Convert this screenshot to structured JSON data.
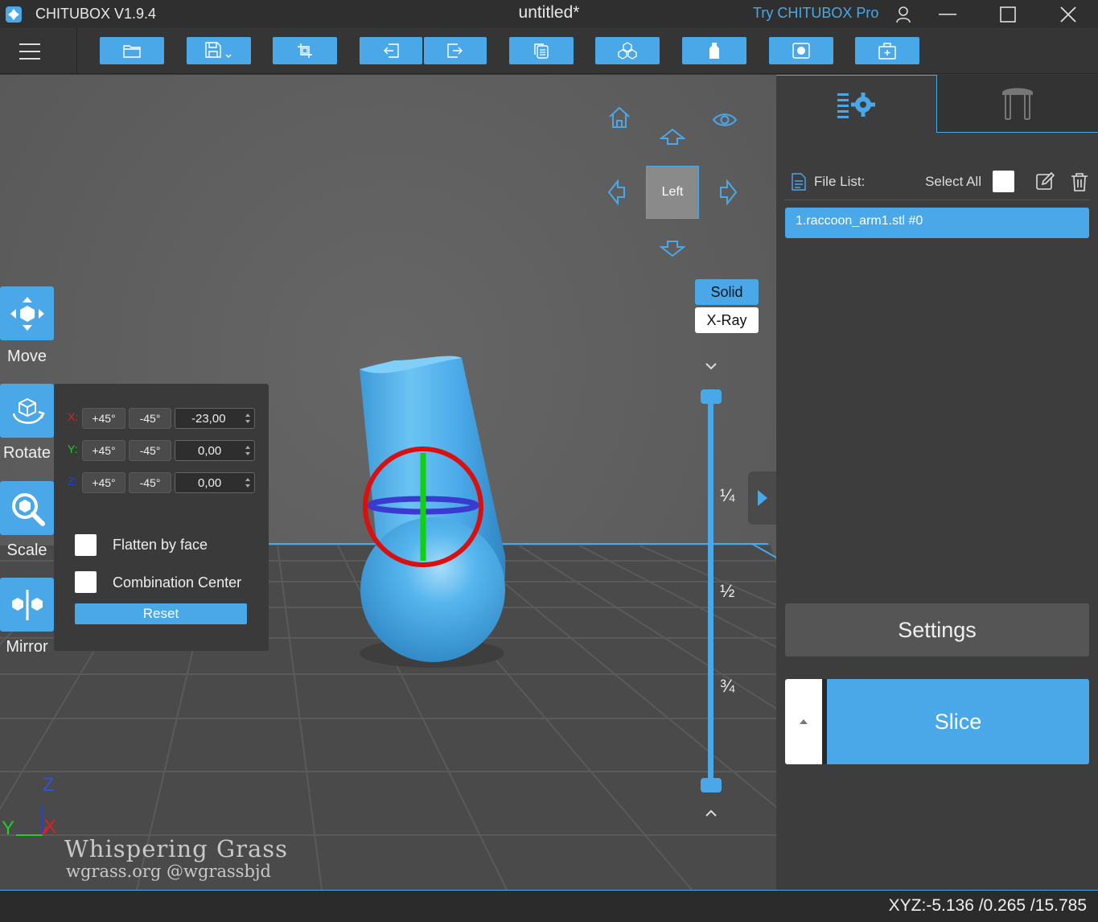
{
  "titlebar": {
    "app_name": "CHITUBOX V1.9.4",
    "document_title": "untitled*",
    "try_pro": "Try CHITUBOX Pro"
  },
  "toolbar": {
    "buttons": [
      "open-file-icon",
      "save-icon",
      "crop-icon",
      "undo-icon",
      "redo-icon",
      "copy-icon",
      "arrange-icon",
      "hollow-icon",
      "dig-hole-icon",
      "supports-icon"
    ]
  },
  "viewport": {
    "view_cube_label": "Left",
    "render_modes": {
      "solid": "Solid",
      "xray": "X-Ray"
    },
    "slider_marks": [
      "¼",
      "½",
      "¾"
    ],
    "axis": {
      "z": "Z",
      "y": "Y",
      "x": "X"
    },
    "watermark": {
      "line1": "Whispering Grass",
      "line2": "wgrass.org @wgrassbjd"
    }
  },
  "tools": {
    "move": "Move",
    "rotate": "Rotate",
    "scale": "Scale",
    "mirror": "Mirror"
  },
  "rotate_panel": {
    "rows": [
      {
        "axis": "X:",
        "plus": "+45°",
        "minus": "-45°",
        "value": "-23,00",
        "color": "#e02020"
      },
      {
        "axis": "Y:",
        "plus": "+45°",
        "minus": "-45°",
        "value": "0,00",
        "color": "#20d020"
      },
      {
        "axis": "Z:",
        "plus": "+45°",
        "minus": "-45°",
        "value": "0,00",
        "color": "#2040e0"
      }
    ],
    "flatten_by_face": "Flatten by face",
    "combination_center": "Combination Center",
    "reset": "Reset"
  },
  "right_panel": {
    "file_list_label": "File List:",
    "select_all": "Select All",
    "files": [
      "1.raccoon_arm1.stl #0"
    ],
    "settings": "Settings",
    "slice": "Slice"
  },
  "status": {
    "coords": "XYZ:-5.136 /0.265 /15.785"
  },
  "colors": {
    "accent": "#4aa8e8",
    "model": "#4fb0e8",
    "viewport_bg": "#595959"
  }
}
